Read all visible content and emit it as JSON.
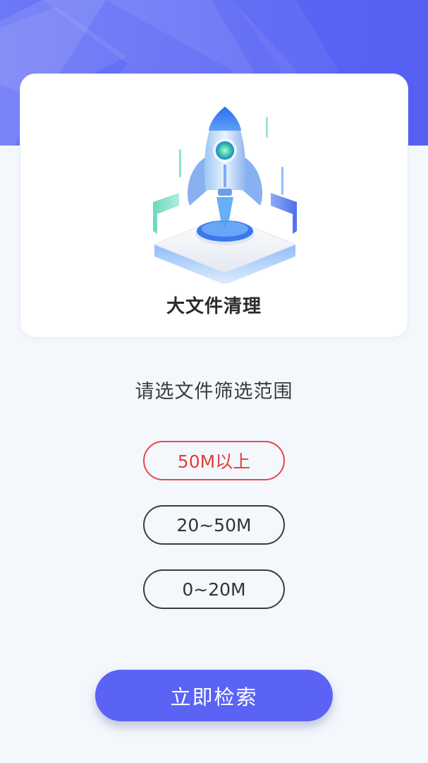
{
  "header": {
    "accent_color": "#5b66f5"
  },
  "hero": {
    "title": "大文件清理",
    "illustration": "rocket-launch-platform-illustration"
  },
  "filter": {
    "prompt": "请选文件筛选范围",
    "options": [
      {
        "label": "50M以上",
        "selected": true
      },
      {
        "label": "20~50M",
        "selected": false
      },
      {
        "label": "0~20M",
        "selected": false
      }
    ],
    "selected_color": "#e33d3d"
  },
  "actions": {
    "search_label": "立即检索",
    "button_color": "#5a63f3"
  }
}
